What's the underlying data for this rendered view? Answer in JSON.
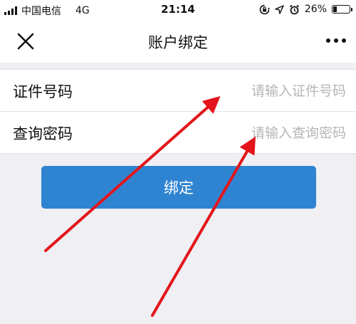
{
  "status_bar": {
    "carrier": "中国电信",
    "network": "4G",
    "time": "21:14",
    "battery_percent": "26%",
    "battery_level": 0.26,
    "icons": [
      "signal-bars-icon",
      "screen-rotation-lock-icon",
      "location-arrow-icon",
      "alarm-clock-icon",
      "battery-icon"
    ]
  },
  "nav": {
    "title": "账户绑定",
    "left_icon": "close-icon",
    "right_icon": "more-dots-icon"
  },
  "form": {
    "rows": [
      {
        "label": "证件号码",
        "placeholder": "请输入证件号码",
        "value": ""
      },
      {
        "label": "查询密码",
        "placeholder": "请输入查询密码",
        "value": ""
      }
    ]
  },
  "button": {
    "label": "绑定"
  },
  "colors": {
    "primary_button": "#2f84d2",
    "background": "#efeff4",
    "annotation_arrow": "#e3151a",
    "placeholder_text": "#b5b5b5"
  }
}
